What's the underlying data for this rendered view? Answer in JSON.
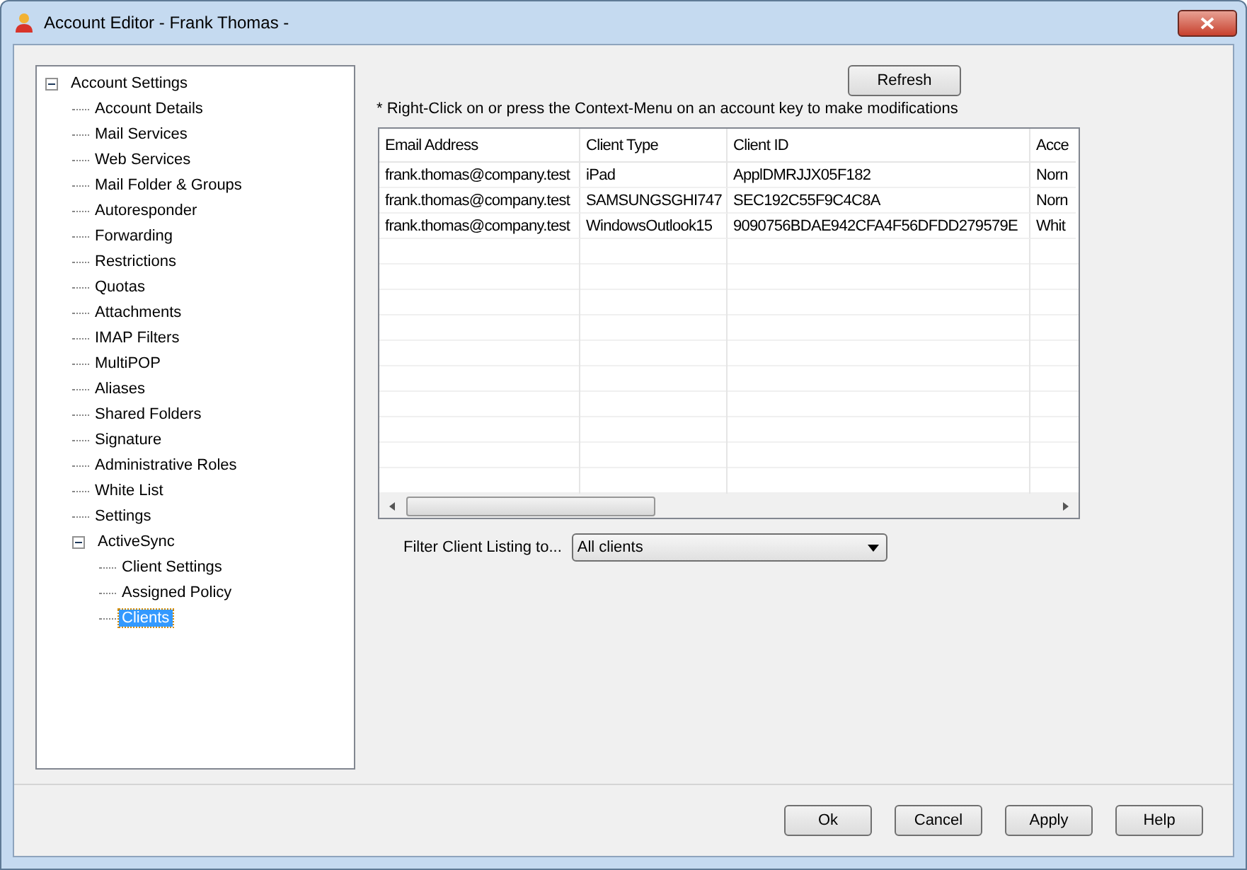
{
  "window": {
    "title": "Account Editor - Frank Thomas -"
  },
  "tree": [
    {
      "label": "Account Settings",
      "expanded": true,
      "selected": false,
      "children": [
        {
          "label": "Account Details",
          "selected": false
        },
        {
          "label": "Mail Services",
          "selected": false
        },
        {
          "label": "Web Services",
          "selected": false
        },
        {
          "label": "Mail Folder & Groups",
          "selected": false
        },
        {
          "label": "Autoresponder",
          "selected": false
        },
        {
          "label": "Forwarding",
          "selected": false
        },
        {
          "label": "Restrictions",
          "selected": false
        },
        {
          "label": "Quotas",
          "selected": false
        },
        {
          "label": "Attachments",
          "selected": false
        },
        {
          "label": "IMAP Filters",
          "selected": false
        },
        {
          "label": "MultiPOP",
          "selected": false
        },
        {
          "label": "Aliases",
          "selected": false
        },
        {
          "label": "Shared Folders",
          "selected": false
        },
        {
          "label": "Signature",
          "selected": false
        },
        {
          "label": "Administrative Roles",
          "selected": false
        },
        {
          "label": "White List",
          "selected": false
        },
        {
          "label": "Settings",
          "selected": false
        },
        {
          "label": "ActiveSync",
          "expanded": true,
          "selected": false,
          "children": [
            {
              "label": "Client Settings",
              "selected": false
            },
            {
              "label": "Assigned Policy",
              "selected": false
            },
            {
              "label": "Clients",
              "selected": true
            }
          ]
        }
      ]
    }
  ],
  "refresh_button": "Refresh",
  "hint": "* Right-Click on or press the Context-Menu on an account key to make modifications",
  "table": {
    "columns": [
      "Email Address",
      "Client Type",
      "Client ID",
      "Acce"
    ],
    "rows": [
      [
        "frank.thomas@company.test",
        "iPad",
        "ApplDMRJJX05F182",
        "Norn"
      ],
      [
        "frank.thomas@company.test",
        "SAMSUNGSGHI747",
        "SEC192C55F9C4C8A",
        "Norn"
      ],
      [
        "frank.thomas@company.test",
        "WindowsOutlook15",
        "9090756BDAE942CFA4F56DFDD279579E",
        "Whit"
      ]
    ]
  },
  "filter": {
    "label": "Filter Client Listing to...",
    "value": "All clients"
  },
  "buttons": [
    "Ok",
    "Cancel",
    "Apply",
    "Help"
  ]
}
